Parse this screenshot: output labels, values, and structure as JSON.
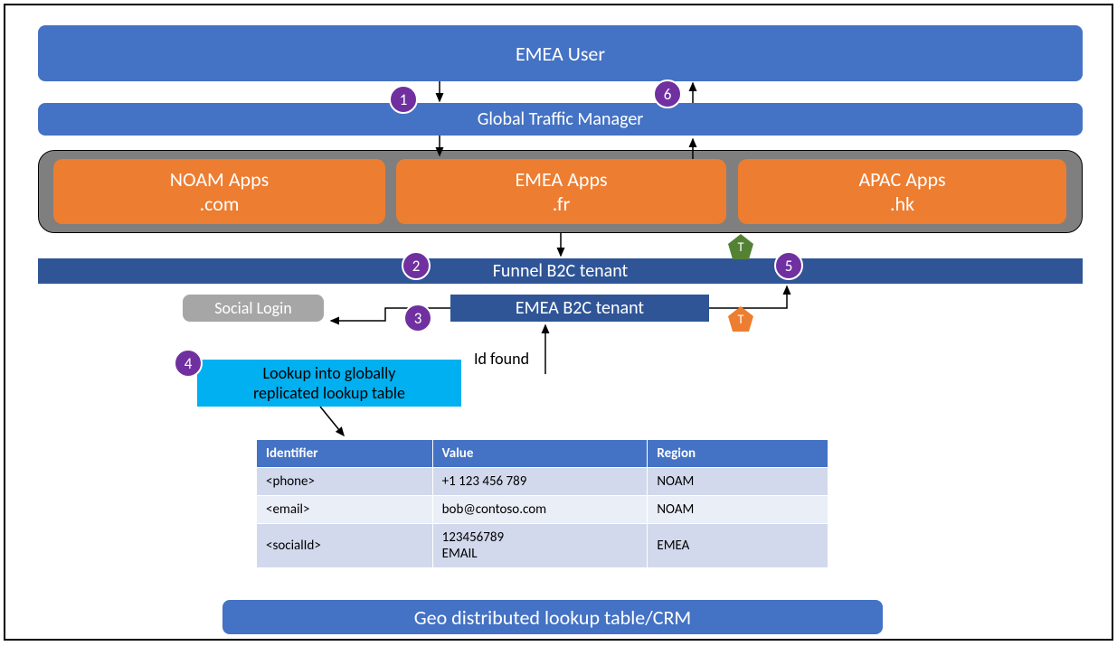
{
  "topbars": {
    "emea_user": "EMEA User",
    "gtm": "Global Traffic Manager"
  },
  "apps": {
    "noam_l1": "NOAM Apps",
    "noam_l2": ".com",
    "emea_l1": "EMEA Apps",
    "emea_l2": ".fr",
    "apac_l1": "APAC Apps",
    "apac_l2": ".hk"
  },
  "tenants": {
    "funnel": "Funnel B2C tenant",
    "emea": "EMEA B2C tenant"
  },
  "social_login": "Social Login",
  "lookup_box_l1": "Lookup into globally",
  "lookup_box_l2": "replicated lookup table",
  "id_found": "Id found",
  "geo_bar": "Geo distributed lookup table/CRM",
  "steps": {
    "s1": "1",
    "s2": "2",
    "s3": "3",
    "s4": "4",
    "s5": "5",
    "s6": "6"
  },
  "tokens": {
    "t1": "T",
    "t2": "T"
  },
  "table": {
    "headers": [
      "Identifier",
      "Value",
      "Region"
    ],
    "rows": [
      [
        "<phone>",
        "+1 123 456 789",
        "NOAM"
      ],
      [
        "<email>",
        "bob@contoso.com",
        "NOAM"
      ],
      [
        "<socialId>",
        "123456789\nEMAIL",
        "EMEA"
      ]
    ]
  }
}
